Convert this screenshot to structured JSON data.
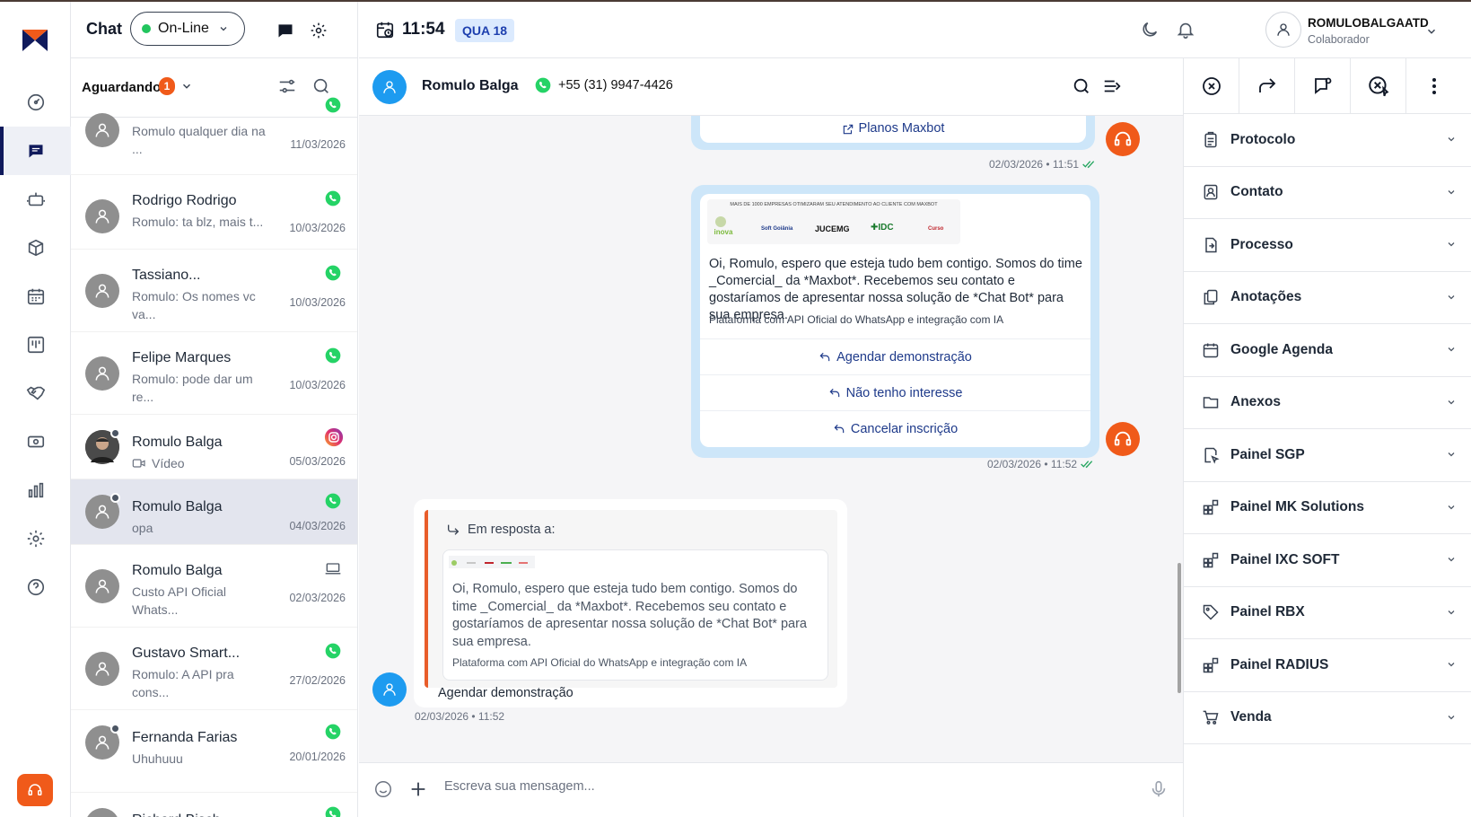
{
  "header": {
    "chat_title": "Chat",
    "status_label": "On-Line",
    "time": "11:54",
    "day": "QUA 18",
    "user_name": "ROMULOBALGAATD",
    "user_role": "Colaborador"
  },
  "list": {
    "filter_label": "Aguardando",
    "filter_count": "1",
    "items": [
      {
        "name": "",
        "preview": "Romulo qualquer dia na ...",
        "date": "11/03/2026",
        "channel": "whatsapp-icon"
      },
      {
        "name": "Rodrigo Rodrigo",
        "preview": "Romulo: ta blz, mais t...",
        "date": "10/03/2026",
        "channel": "whatsapp-icon"
      },
      {
        "name": "Tassiano...",
        "preview": "Romulo: Os nomes vc va...",
        "date": "10/03/2026",
        "channel": "whatsapp-icon"
      },
      {
        "name": "Felipe Marques",
        "preview": "Romulo: pode dar um re...",
        "date": "10/03/2026",
        "channel": "whatsapp-icon"
      },
      {
        "name": "Romulo Balga",
        "preview": "Vídeo",
        "date": "05/03/2026",
        "channel": "instagram-icon"
      },
      {
        "name": "Romulo Balga",
        "preview": "opa",
        "date": "04/03/2026",
        "channel": "whatsapp-icon"
      },
      {
        "name": "Romulo Balga",
        "preview": "Custo API Oficial Whats...",
        "date": "02/03/2026",
        "channel": "laptop-icon"
      },
      {
        "name": "Gustavo Smart...",
        "preview": "Romulo: A API pra cons...",
        "date": "27/02/2026",
        "channel": "whatsapp-icon"
      },
      {
        "name": "Fernanda Farias",
        "preview": "Uhuhuuu",
        "date": "20/01/2026",
        "channel": "whatsapp-icon"
      },
      {
        "name": "Richard Bisch",
        "preview": "",
        "date": "",
        "channel": "whatsapp-icon"
      }
    ]
  },
  "conversation": {
    "contact_name": "Romulo Balga",
    "contact_phone": "+55 (31) 9947-4426",
    "msg1": {
      "link_label": "Planos Maxbot",
      "time": "02/03/2026 • 11:51"
    },
    "msg2": {
      "banner_caption": "MAIS DE 1000 EMPRESAS OTIMIZARAM SEU ATENDIMENTO AO CLIENTE COM MAXBOT",
      "logos": [
        "inova",
        "Soft Goiânia",
        "JUCEMG",
        "IDC",
        "Curso"
      ],
      "body": "Oi, Romulo, espero que esteja tudo bem contigo. Somos do time _Comercial_ da *Maxbot*. Recebemos seu contato e gostaríamos de apresentar nossa solução de *Chat Bot* para sua empresa.",
      "footer": "Plataforma com API Oficial do WhatsApp e integração com IA",
      "buttons": [
        "Agendar demonstração",
        "Não tenho interesse",
        "Cancelar inscrição"
      ],
      "time": "02/03/2026 • 11:52"
    },
    "msg3": {
      "reply_label": "Em resposta a:",
      "quoted_body": "Oi, Romulo, espero que esteja tudo bem contigo. Somos do time _Comercial_ da *Maxbot*. Recebemos seu contato e gostaríamos de apresentar nossa solução de *Chat Bot* para sua empresa.",
      "quoted_footer": "Plataforma com API Oficial do WhatsApp e integração com IA",
      "text": "Agendar demonstração",
      "time": "02/03/2026 • 11:52"
    },
    "composer_placeholder": "Escreva sua mensagem..."
  },
  "side": {
    "panels": [
      "Protocolo",
      "Contato",
      "Processo",
      "Anotações",
      "Google Agenda",
      "Anexos",
      "Painel SGP",
      "Painel MK Solutions",
      "Painel IXC SOFT",
      "Painel RBX",
      "Painel RADIUS",
      "Venda"
    ]
  },
  "colors": {
    "brand": "#101a5c",
    "accent": "#f05a1a",
    "online": "#22c55e",
    "whatsapp": "#25d366",
    "avatar_blue": "#1d9bf0",
    "bubble_out": "#cde6f9"
  }
}
